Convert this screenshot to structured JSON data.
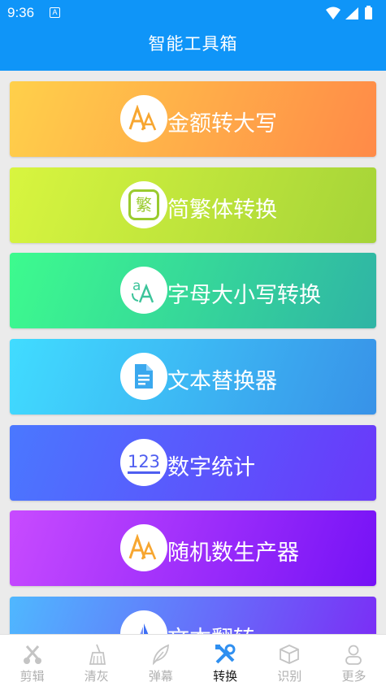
{
  "status": {
    "time": "9:36",
    "notification": "A"
  },
  "app": {
    "title": "智能工具箱"
  },
  "cards": [
    {
      "label": "金额转大写",
      "icon": "font-aa-icon"
    },
    {
      "label": "简繁体转换",
      "icon": "traditional-char-icon",
      "glyph": "繁"
    },
    {
      "label": "字母大小写转换",
      "icon": "letter-case-icon"
    },
    {
      "label": "文本替换器",
      "icon": "document-icon"
    },
    {
      "label": "数字统计",
      "icon": "numbers-123-icon",
      "glyph": "123"
    },
    {
      "label": "随机数生产器",
      "icon": "font-aa-icon"
    },
    {
      "label": "文本翻转",
      "icon": "sail-icon"
    }
  ],
  "tabs": [
    {
      "label": "剪辑",
      "icon": "scissors-icon",
      "active": false
    },
    {
      "label": "清灰",
      "icon": "broom-icon",
      "active": false
    },
    {
      "label": "弹幕",
      "icon": "feather-icon",
      "active": false
    },
    {
      "label": "转换",
      "icon": "tools-icon",
      "active": true
    },
    {
      "label": "识别",
      "icon": "cube-icon",
      "active": false
    },
    {
      "label": "更多",
      "icon": "person-icon",
      "active": false
    }
  ],
  "colors": {
    "primary": "#0f95f8",
    "card1": [
      "#ffd04a",
      "#ff8a48"
    ],
    "card2": [
      "#d8f53f",
      "#a5d438"
    ],
    "card3": [
      "#3dfb8e",
      "#2fb4a5"
    ],
    "card4": [
      "#41dcff",
      "#3892e8"
    ],
    "card5": [
      "#4a78ff",
      "#6a38fa"
    ],
    "card6": [
      "#c84bff",
      "#7512f6"
    ],
    "card7": [
      "#4fb8ff",
      "#7c2af5"
    ]
  }
}
